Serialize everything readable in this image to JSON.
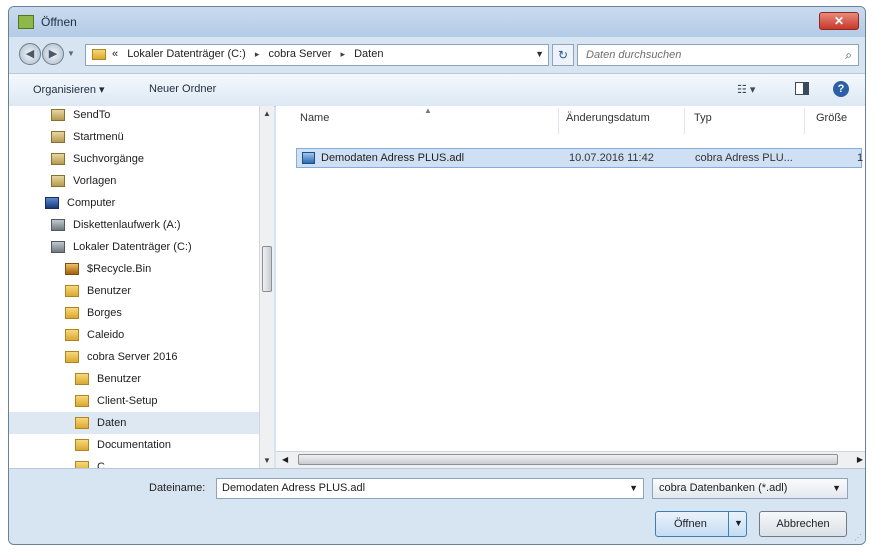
{
  "window": {
    "title": "Öffnen",
    "close_glyph": "✕"
  },
  "nav": {
    "back_glyph": "◀",
    "forward_glyph": "▶",
    "breadcrumb_prefix": "«",
    "breadcrumbs": [
      "Lokaler Datenträger (C:)",
      "cobra Server",
      "Daten"
    ],
    "separator": "▸",
    "refresh_glyph": "↻",
    "search_placeholder": "Daten durchsuchen"
  },
  "toolbar": {
    "organize_label": "Organisieren ▾",
    "new_folder_label": "Neuer Ordner",
    "help_glyph": "?"
  },
  "tree": [
    {
      "label": "SendTo",
      "icon": "special-folder-icon"
    },
    {
      "label": "Startmenü",
      "icon": "special-folder-icon"
    },
    {
      "label": "Suchvorgänge",
      "icon": "special-folder-icon"
    },
    {
      "label": "Vorlagen",
      "icon": "special-folder-icon"
    },
    {
      "label": "Computer",
      "icon": "computer-icon"
    },
    {
      "label": "Diskettenlaufwerk (A:)",
      "icon": "floppy-drive-icon"
    },
    {
      "label": "Lokaler Datenträger (C:)",
      "icon": "hard-drive-icon"
    },
    {
      "label": "$Recycle.Bin",
      "icon": "recycle-bin-icon"
    },
    {
      "label": "Benutzer",
      "icon": "folder-icon"
    },
    {
      "label": "Borges",
      "icon": "folder-icon"
    },
    {
      "label": "Caleido",
      "icon": "folder-icon"
    },
    {
      "label": "cobra Server 2016",
      "icon": "folder-icon"
    },
    {
      "label": "Benutzer",
      "icon": "folder-icon"
    },
    {
      "label": "Client-Setup",
      "icon": "folder-icon"
    },
    {
      "label": "Daten",
      "icon": "folder-icon",
      "selected": true
    },
    {
      "label": "Documentation",
      "icon": "folder-icon"
    },
    {
      "label": "C...",
      "icon": "folder-icon"
    }
  ],
  "columns": {
    "name": "Name",
    "date": "Änderungsdatum",
    "type": "Typ",
    "size": "Größe"
  },
  "files": [
    {
      "name": "Demodaten Adress PLUS.adl",
      "date": "10.07.2016 11:42",
      "type": "cobra Adress PLU...",
      "size": "1"
    }
  ],
  "footer": {
    "filename_label": "Dateiname:",
    "filename_value": "Demodaten Adress PLUS.adl",
    "filter_value": "cobra Datenbanken (*.adl)",
    "open_label": "Öffnen",
    "cancel_label": "Abbrechen"
  },
  "colors": {
    "accent": "#3c7fb1",
    "selection": "#cfe0f4",
    "chrome": "#d7e4f2"
  }
}
